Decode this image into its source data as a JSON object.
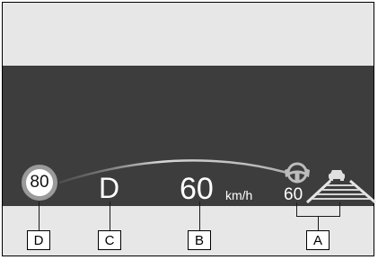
{
  "display": {
    "speed_limit": "80",
    "gear": "D",
    "speed": "60",
    "speed_unit": "km/h",
    "set_speed": "60"
  },
  "callouts": {
    "a": "A",
    "b": "B",
    "c": "C",
    "d": "D"
  },
  "icons": {
    "steering_assist": "steering-wheel-hands-icon",
    "lead_vehicle": "lead-vehicle-icon",
    "lanes": "lane-lines-icon"
  },
  "colors": {
    "display_background": "#3d3d3d",
    "panel_background": "#e7e7e7",
    "speed_limit_ring": "#9a9a9a",
    "text": "#ffffff"
  }
}
